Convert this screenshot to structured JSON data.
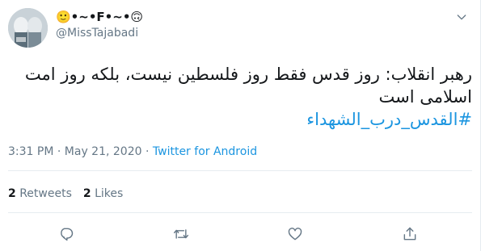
{
  "user": {
    "display_name": "🙂•~•F•~•🙃",
    "handle": "@MissTajabadi"
  },
  "tweet": {
    "line1": "رهبر انقلاب: روز قدس فقط روز فلسطین نیست، بلکه روز امت",
    "line2": "اسلامی است",
    "hashtag": "#القدس_درب_الشهداء"
  },
  "meta": {
    "time": "3:31 PM",
    "date": "May 21, 2020",
    "separator": "·",
    "source": "Twitter for Android"
  },
  "stats": {
    "retweets_count": "2",
    "retweets_label": "Retweets",
    "likes_count": "2",
    "likes_label": "Likes"
  },
  "icons": {
    "more": "chevron-down-icon",
    "reply": "reply-icon",
    "retweet": "retweet-icon",
    "like": "heart-icon",
    "share": "share-icon"
  },
  "colors": {
    "link": "#1b95e0",
    "secondary_text": "#657786",
    "icon": "#657786",
    "divider": "#e6ecf0"
  }
}
